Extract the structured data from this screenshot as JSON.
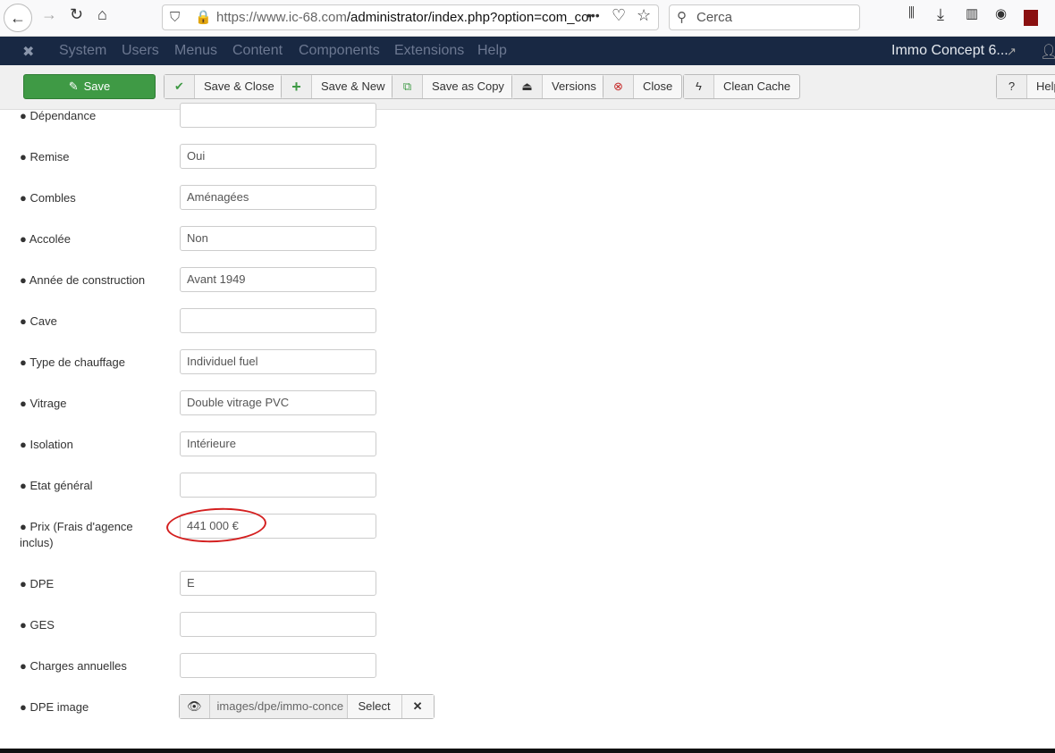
{
  "browser": {
    "url_host": "https://www.ic-68.com",
    "url_path": "/administrator/index.php?option=com_cor",
    "search_placeholder": "Cerca"
  },
  "nav": {
    "items": [
      "System",
      "Users",
      "Menus",
      "Content",
      "Components",
      "Extensions",
      "Help"
    ],
    "site": "Immo Concept 6..."
  },
  "toolbar": {
    "save": "Save",
    "save_close": "Save & Close",
    "save_new": "Save & New",
    "save_copy": "Save as Copy",
    "versions": "Versions",
    "close": "Close",
    "clean_cache": "Clean Cache",
    "help": "Help"
  },
  "fields": [
    {
      "label": "Dépendance",
      "value": ""
    },
    {
      "label": "Remise",
      "value": "Oui"
    },
    {
      "label": "Combles",
      "value": "Aménagées"
    },
    {
      "label": "Accolée",
      "value": "Non"
    },
    {
      "label": "Année de construction",
      "value": "Avant 1949"
    },
    {
      "label": "Cave",
      "value": ""
    },
    {
      "label": "Type de chauffage",
      "value": "Individuel fuel"
    },
    {
      "label": "Vitrage",
      "value": "Double vitrage PVC"
    },
    {
      "label": "Isolation",
      "value": "Intérieure"
    },
    {
      "label": "Etat général",
      "value": ""
    },
    {
      "label": "Prix (Frais d'agence inclus)",
      "value": "441 000 €"
    },
    {
      "label": "DPE",
      "value": "E"
    },
    {
      "label": "GES",
      "value": ""
    },
    {
      "label": "Charges annuelles",
      "value": ""
    }
  ],
  "dpe_image": {
    "label": "DPE image",
    "value": "images/dpe/immo-conce",
    "select": "Select"
  }
}
